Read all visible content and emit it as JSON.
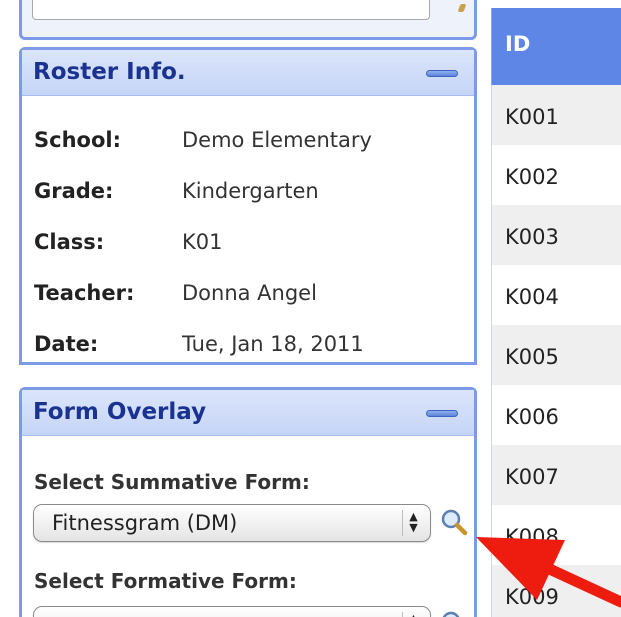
{
  "roster": {
    "title": "Roster Info.",
    "rows": [
      {
        "label": "School:",
        "value": "Demo Elementary"
      },
      {
        "label": "Grade:",
        "value": "Kindergarten"
      },
      {
        "label": "Class:",
        "value": "K01"
      },
      {
        "label": "Teacher:",
        "value": "Donna Angel"
      },
      {
        "label": "Date:",
        "value": "Tue, Jan 18, 2011"
      }
    ]
  },
  "overlay": {
    "title": "Form Overlay",
    "summative_label": "Select Summative Form:",
    "summative_value": "Fitnessgram (DM)",
    "formative_label": "Select Formative Form:"
  },
  "table": {
    "header": "ID",
    "rows": [
      "K001",
      "K002",
      "K003",
      "K004",
      "K005",
      "K006",
      "K007",
      "K008",
      "K009"
    ]
  },
  "colors": {
    "panel_border": "#7d9ae6",
    "panel_title": "#1a3390",
    "table_header": "#5d86e6",
    "annotation_arrow": "#ee1c0e"
  },
  "icons": {
    "collapse": "minus-bar-icon",
    "search": "magnifier-icon",
    "select_arrows": "up-down-arrows-icon"
  }
}
